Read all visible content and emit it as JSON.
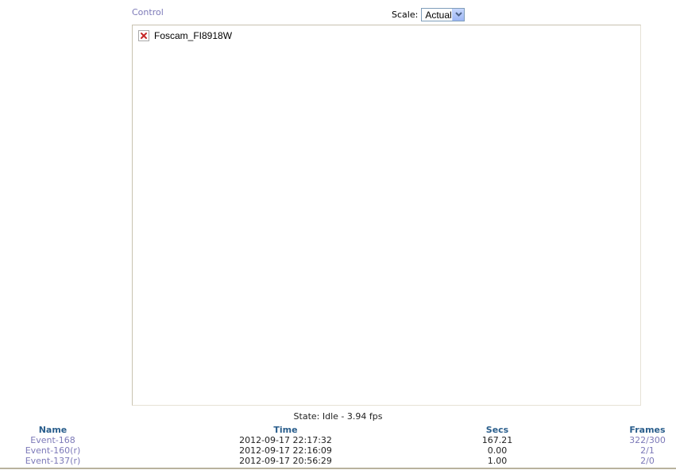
{
  "control": {
    "label": "Control"
  },
  "scale": {
    "label": "Scale:",
    "selected": "Actual"
  },
  "stream": {
    "alt_text": "Foscam_FI8918W"
  },
  "status": {
    "text": "State: Idle - 3.94 fps"
  },
  "events": {
    "columns": [
      "Name",
      "Time",
      "Secs",
      "Frames"
    ],
    "rows": [
      {
        "name": "Event-168",
        "time": "2012-09-17 22:17:32",
        "secs": "167.21",
        "frames": "322/300"
      },
      {
        "name": "Event-160(r)",
        "time": "2012-09-17 22:16:09",
        "secs": "0.00",
        "frames": "2/1"
      },
      {
        "name": "Event-137(r)",
        "time": "2012-09-17 20:56:29",
        "secs": "1.00",
        "frames": "2/0"
      }
    ]
  },
  "colors": {
    "link": "#7c79b8",
    "header": "#2a5e8c",
    "broken_x": "#c62828"
  }
}
